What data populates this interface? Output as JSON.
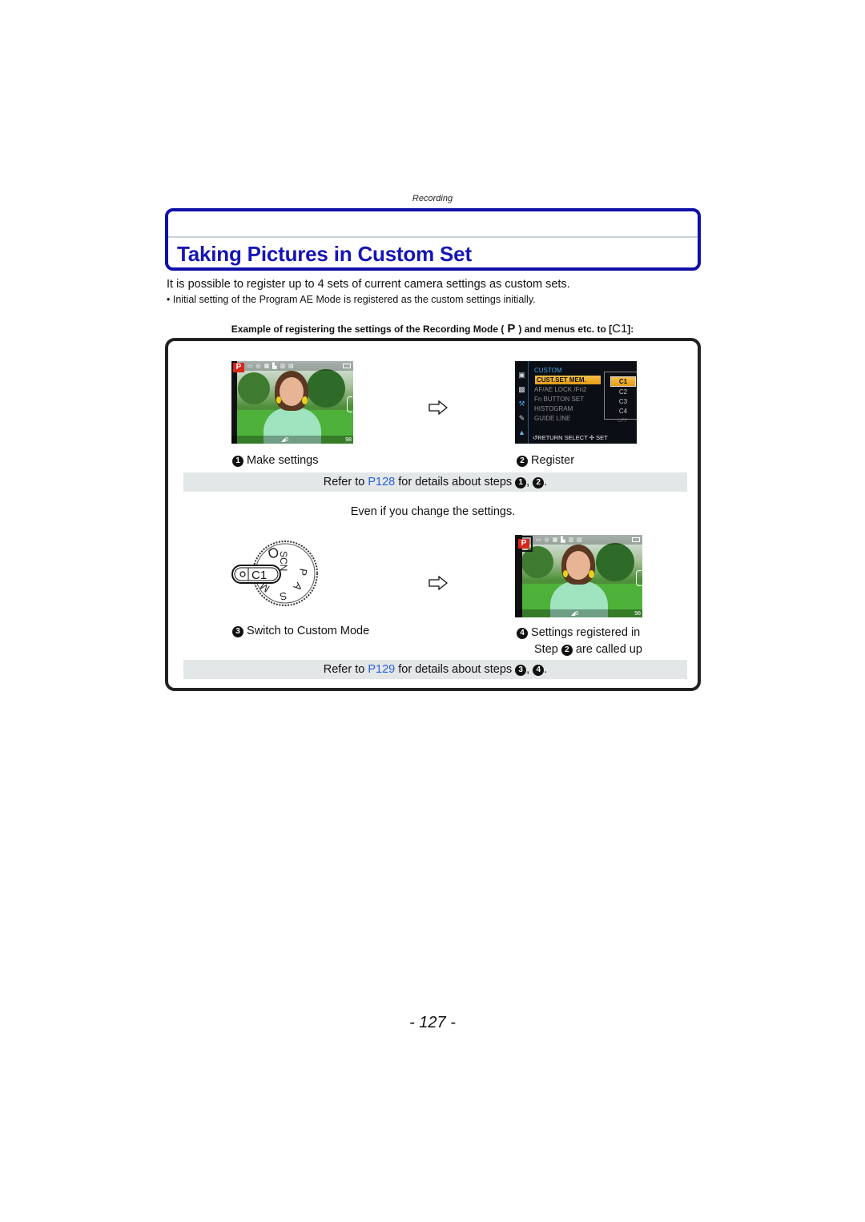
{
  "header": {
    "section": "Recording",
    "title": "Taking Pictures in Custom Set"
  },
  "intro": {
    "text": "It is possible to register up to 4 sets of current camera settings as custom sets.",
    "note": "Initial setting of the Program AE Mode is registered as the custom settings initially.",
    "note_bullet": "•"
  },
  "example": {
    "prefix": "Example of registering the settings of the Recording Mode (",
    "mode_glyph": "P",
    "middle": ") and menus etc. to [",
    "custom_glyph": "C1",
    "suffix": "]:"
  },
  "camera_screen": {
    "mode_badge": "P",
    "icons_row": "▭ ◎ ▦ ▙  ▥ ▤",
    "ev": "◢0",
    "count": "98"
  },
  "menu_screen": {
    "tabs": [
      "▣",
      "▩",
      "⚒",
      "✎",
      "▲"
    ],
    "heading": "CUSTOM",
    "items": [
      {
        "label": "CUST.SET MEM.",
        "selected": true
      },
      {
        "label": "AF/AE LOCK /Fn2",
        "selected": false
      },
      {
        "label": "Fn BUTTON SET",
        "selected": false
      },
      {
        "label": "HISTOGRAM",
        "selected": false
      },
      {
        "label": "GUIDE LINE",
        "selected": false
      }
    ],
    "options": [
      {
        "label": "C1",
        "selected": true
      },
      {
        "label": "C2",
        "selected": false
      },
      {
        "label": "C3",
        "selected": false
      },
      {
        "label": "C4",
        "selected": false
      }
    ],
    "off_label": "OFF",
    "footer": "↺RETURN  SELECT ✣  SET"
  },
  "steps": [
    {
      "num": "1",
      "label": "Make settings"
    },
    {
      "num": "2",
      "label": "Register"
    },
    {
      "num": "3",
      "label": "Switch to Custom Mode"
    },
    {
      "num": "4",
      "label_line1": "Settings registered in",
      "label_line2_prefix": "Step",
      "label_line2_num": "2",
      "label_line2_suffix": "are called up"
    }
  ],
  "refs": [
    {
      "prefix": "Refer to",
      "link": "P128",
      "middle": "for details about steps",
      "n1": "1",
      "sep": ",",
      "n2": "2",
      "end": "."
    },
    {
      "prefix": "Refer to",
      "link": "P129",
      "middle": "for details about steps",
      "n1": "3",
      "sep": ",",
      "n2": "4",
      "end": "."
    }
  ],
  "even_text": "Even if you change the settings.",
  "dial": {
    "selected": "C1",
    "labels": [
      "SCN",
      "P",
      "A",
      "S",
      "M"
    ]
  },
  "colors": {
    "title_blue": "#1515b4",
    "link_blue": "#2a5fd8",
    "band_gray": "#e3e7e8",
    "menu_highlight": "#f0b030"
  },
  "page_number": "- 127 -"
}
